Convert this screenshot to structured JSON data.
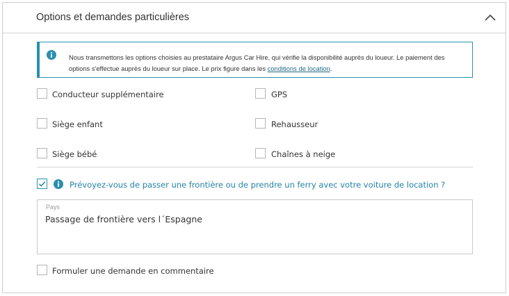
{
  "header": {
    "title": "Options et demandes particulières",
    "collapse_icon": "chevron-up-icon"
  },
  "info": {
    "icon": "info-icon",
    "text": "Nous transmettons les options choisies au prestataire Argus Car Hire, qui vérifie la disponibilité auprès du loueur. Le paiement des options s'effectue auprès du loueur sur place. Le prix figure dans les ",
    "link_text": "conditions de location",
    "text_end": "."
  },
  "options": [
    {
      "label": "Conducteur supplémentaire",
      "checked": false
    },
    {
      "label": "GPS",
      "checked": false
    },
    {
      "label": "Siège enfant",
      "checked": false
    },
    {
      "label": "Rehausseur",
      "checked": false
    },
    {
      "label": "Siège bébé",
      "checked": false
    },
    {
      "label": "Chaînes à neige",
      "checked": false
    }
  ],
  "border_question": {
    "checked": true,
    "icon": "info-icon",
    "text": "Prévoyez-vous de passer une frontière ou de prendre un ferry avec votre voiture de location ?"
  },
  "country_field": {
    "label": "Pays",
    "value": "Passage de frontière vers l´Espagne"
  },
  "comment_request": {
    "label": "Formuler une demande en commentaire",
    "checked": false
  },
  "colors": {
    "accent": "#2a8fb0",
    "link": "#1f6a86",
    "border": "#cfcfcf"
  }
}
